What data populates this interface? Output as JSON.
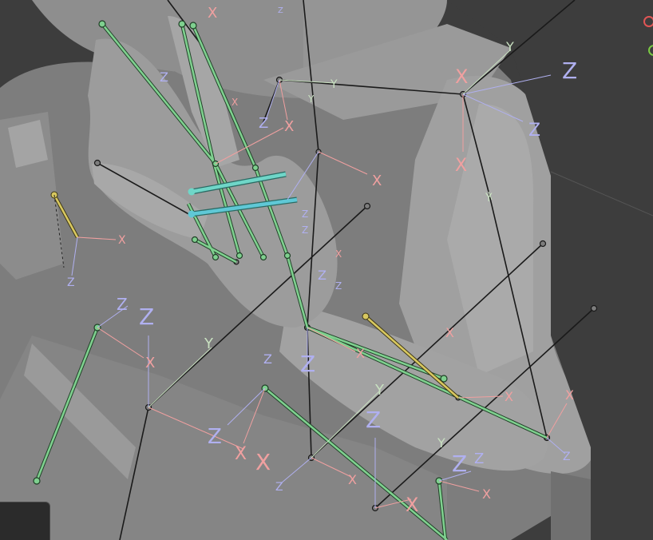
{
  "viewport": {
    "background": "#3d3d3d",
    "model_color": "#8a8a8a",
    "model_shadow": "#6e6e6e",
    "model_highlight": "#a3a3a3"
  },
  "colors": {
    "bone_selected": "#7fd08f",
    "bone_active": "#6fd6c8",
    "bone_unselected": "#1a1a1a",
    "bone_yellow": "#d8c860",
    "axis_x": "#f0a0a0",
    "axis_y": "#c8e0c0",
    "axis_z": "#b0b0f0"
  },
  "axis_letters": {
    "x": "X",
    "y": "Y",
    "z": "Z"
  },
  "gizmo": {
    "x_color": "#e05555",
    "y_color": "#7ac943",
    "x_icon": "gizmo-x-circle-icon",
    "y_icon": "gizmo-y-circle-icon"
  }
}
